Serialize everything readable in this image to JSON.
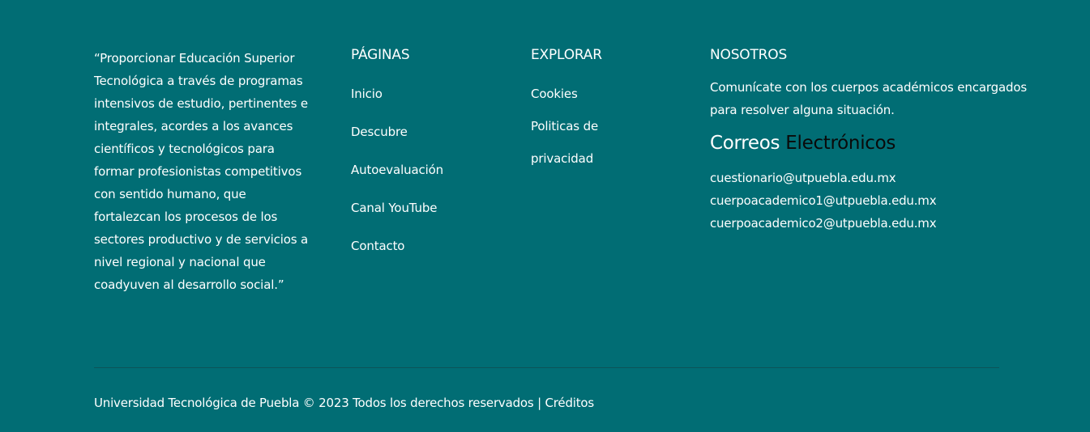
{
  "footer": {
    "mission_text": "“Proporcionar Educación Superior Tecnológica a través de programas intensivos de estudio, pertinentes e integrales, acordes a los avances científicos y tecnológicos para formar profesionistas competitivos con sentido humano, que fortalezcan los procesos de los sectores productivo y de servicios a nivel regional y nacional que coadyuven al desarrollo social.”",
    "paginas": {
      "heading": "PÁGINAS",
      "items": [
        {
          "label": "Inicio"
        },
        {
          "label": "Descubre"
        },
        {
          "label": "Autoevaluación"
        },
        {
          "label": "Canal YouTube"
        },
        {
          "label": "Contacto"
        }
      ]
    },
    "explorar": {
      "heading": "EXPLORAR",
      "items": [
        {
          "label": "Cookies"
        },
        {
          "label": "Politicas de privacidad"
        }
      ]
    },
    "nosotros": {
      "heading": "NOSOTROS",
      "text": "Comunícate con los cuerpos académicos encargados para resolver alguna situación.",
      "emails_heading_part1": "Correos",
      "emails_heading_part2": "Electrónicos",
      "emails": [
        "cuestionario@utpuebla.edu.mx",
        "cuerpoacademico1@utpuebla.edu.mx",
        "cuerpoacademico2@utpuebla.edu.mx"
      ]
    },
    "bottom": {
      "copyright": "Universidad Tecnológica de Puebla © 2023 Todos los derechos reservados |",
      "credits_label": "Créditos"
    },
    "colors": {
      "background": "#016d74",
      "text": "#ffffff",
      "accent_dark": "#0a0a0a",
      "divider": "#0c5358"
    }
  }
}
